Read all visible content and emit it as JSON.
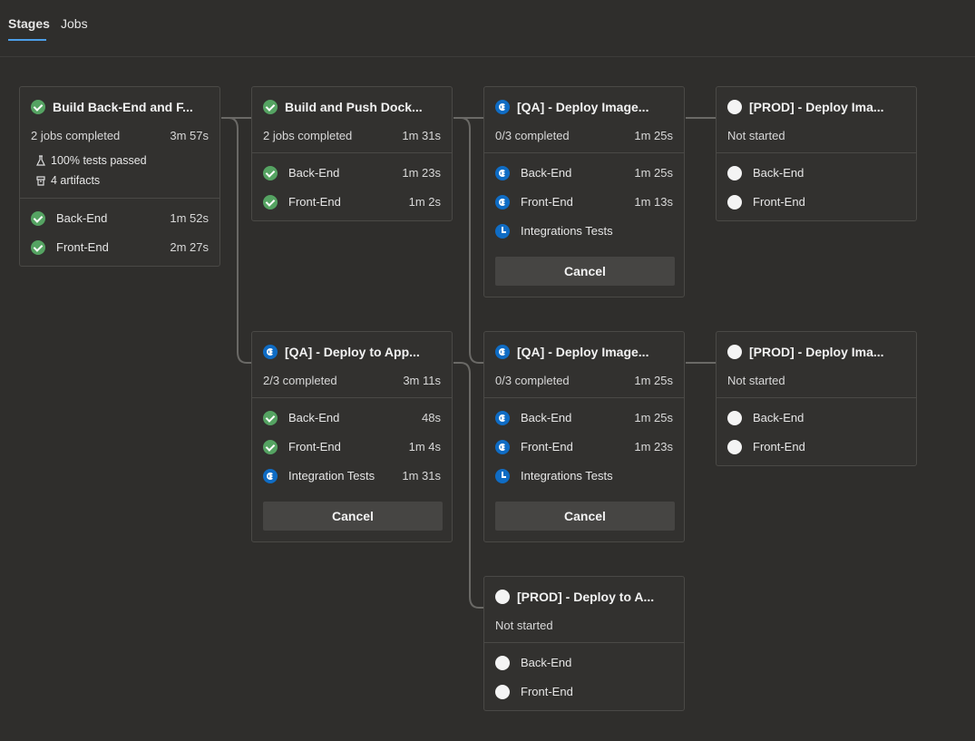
{
  "tabs": {
    "stages": "Stages",
    "jobs": "Jobs"
  },
  "accent": "#4c9ee8",
  "status_colors": {
    "success": "#55a362",
    "running": "#0f6cc4",
    "not_started": "#f4f4f4"
  },
  "cards": [
    {
      "title": "Build Back-End and F...",
      "status": "success",
      "summary": "2 jobs completed",
      "duration": "3m 57s",
      "meta": {
        "tests": "100% tests passed",
        "artifacts": "4 artifacts",
        "tests_icon": "flask-icon",
        "artifacts_icon": "box-icon"
      },
      "jobs": [
        {
          "name": "Back-End",
          "duration": "1m 52s",
          "status": "success"
        },
        {
          "name": "Front-End",
          "duration": "2m 27s",
          "status": "success"
        }
      ]
    },
    {
      "title": "Build and Push Dock...",
      "status": "success",
      "summary": "2 jobs completed",
      "duration": "1m 31s",
      "jobs": [
        {
          "name": "Back-End",
          "duration": "1m 23s",
          "status": "success"
        },
        {
          "name": "Front-End",
          "duration": "1m 2s",
          "status": "success"
        }
      ]
    },
    {
      "title": "[QA] - Deploy Image...",
      "status": "running",
      "summary": "0/3 completed",
      "duration": "1m 25s",
      "cancel": "Cancel",
      "jobs": [
        {
          "name": "Back-End",
          "duration": "1m 25s",
          "status": "running"
        },
        {
          "name": "Front-End",
          "duration": "1m 13s",
          "status": "running"
        },
        {
          "name": "Integrations Tests",
          "duration": "",
          "status": "queued"
        }
      ]
    },
    {
      "title": "[PROD] - Deploy Ima...",
      "status": "not_started",
      "summary": "Not started",
      "duration": "",
      "jobs": [
        {
          "name": "Back-End",
          "duration": "",
          "status": "not_started"
        },
        {
          "name": "Front-End",
          "duration": "",
          "status": "not_started"
        }
      ]
    },
    {
      "title": "[QA] - Deploy to App...",
      "status": "running",
      "summary": "2/3 completed",
      "duration": "3m 11s",
      "cancel": "Cancel",
      "jobs": [
        {
          "name": "Back-End",
          "duration": "48s",
          "status": "success"
        },
        {
          "name": "Front-End",
          "duration": "1m 4s",
          "status": "success"
        },
        {
          "name": "Integration Tests",
          "duration": "1m 31s",
          "status": "running"
        }
      ]
    },
    {
      "title": "[QA] - Deploy Image...",
      "status": "running",
      "summary": "0/3 completed",
      "duration": "1m 25s",
      "cancel": "Cancel",
      "jobs": [
        {
          "name": "Back-End",
          "duration": "1m 25s",
          "status": "running"
        },
        {
          "name": "Front-End",
          "duration": "1m 23s",
          "status": "running"
        },
        {
          "name": "Integrations Tests",
          "duration": "",
          "status": "queued"
        }
      ]
    },
    {
      "title": "[PROD] - Deploy Ima...",
      "status": "not_started",
      "summary": "Not started",
      "duration": "",
      "jobs": [
        {
          "name": "Back-End",
          "duration": "",
          "status": "not_started"
        },
        {
          "name": "Front-End",
          "duration": "",
          "status": "not_started"
        }
      ]
    },
    {
      "title": "[PROD] - Deploy to A...",
      "status": "not_started",
      "summary": "Not started",
      "duration": "",
      "jobs": [
        {
          "name": "Back-End",
          "duration": "",
          "status": "not_started"
        },
        {
          "name": "Front-End",
          "duration": "",
          "status": "not_started"
        }
      ]
    }
  ]
}
